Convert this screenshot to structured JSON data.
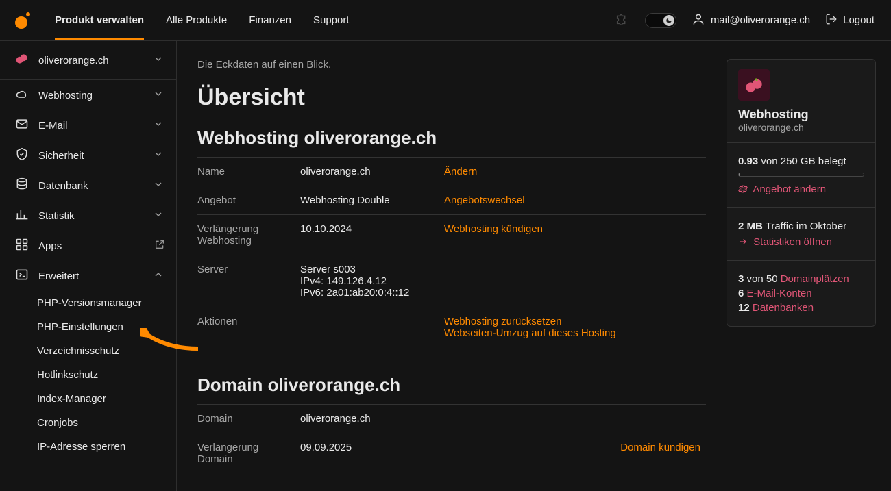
{
  "nav": {
    "items": [
      "Produkt verwalten",
      "Alle Produkte",
      "Finanzen",
      "Support"
    ],
    "active": 0
  },
  "user_email": "mail@oliverorange.ch",
  "logout_label": "Logout",
  "sidebar": {
    "domain": "oliverorange.ch",
    "items": [
      {
        "icon": "cloud",
        "label": "Webhosting",
        "expand": true
      },
      {
        "icon": "mail",
        "label": "E-Mail",
        "expand": true
      },
      {
        "icon": "shield",
        "label": "Sicherheit",
        "expand": true
      },
      {
        "icon": "db",
        "label": "Datenbank",
        "expand": true
      },
      {
        "icon": "stats",
        "label": "Statistik",
        "expand": true
      },
      {
        "icon": "apps",
        "label": "Apps",
        "ext": true
      },
      {
        "icon": "terminal",
        "label": "Erweitert",
        "open": true
      }
    ],
    "sub": [
      "PHP-Versionsmanager",
      "PHP-Einstellungen",
      "Verzeichnisschutz",
      "Hotlinkschutz",
      "Index-Manager",
      "Cronjobs",
      "IP-Adresse sperren"
    ]
  },
  "content": {
    "intro": "Die Eckdaten auf einen Blick.",
    "title": "Übersicht",
    "webhosting": {
      "heading": "Webhosting oliverorange.ch",
      "rows": [
        {
          "k": "Name",
          "v": "oliverorange.ch",
          "actions": [
            "Ändern"
          ]
        },
        {
          "k": "Angebot",
          "v": "Webhosting Double",
          "actions": [
            "Angebotswechsel"
          ]
        },
        {
          "k": "Verlängerung Webhosting",
          "v": "10.10.2024",
          "actions": [
            "Webhosting kündigen"
          ]
        },
        {
          "k": "Server",
          "v": "Server s003\nIPv4: 149.126.4.12\nIPv6: 2a01:ab20:0:4::12",
          "actions": []
        },
        {
          "k": "Aktionen",
          "v": "",
          "actions": [
            "Webhosting zurücksetzen",
            "Webseiten-Umzug auf dieses Hosting"
          ]
        }
      ]
    },
    "domain": {
      "heading": "Domain oliverorange.ch",
      "rows": [
        {
          "k": "Domain",
          "v": "oliverorange.ch",
          "actions": [],
          "align": "left"
        },
        {
          "k": "Verlängerung Domain",
          "v": "09.09.2025",
          "actions": [
            "Domain kündigen"
          ],
          "align": "right"
        }
      ]
    }
  },
  "card": {
    "title": "Webhosting",
    "subtitle": "oliverorange.ch",
    "storage": {
      "used": "0.93",
      "total_suffix": " von 250 GB belegt"
    },
    "change_plan": "Angebot ändern",
    "traffic": {
      "value": "2 MB",
      "suffix": " Traffic im Oktober"
    },
    "stats_link": "Statistiken öffnen",
    "counts": [
      {
        "n": "3",
        "suffix": " von 50 ",
        "link": "Domainplätzen"
      },
      {
        "n": "6",
        "suffix": " ",
        "link": "E-Mail-Konten"
      },
      {
        "n": "12",
        "suffix": " ",
        "link": "Datenbanken"
      }
    ]
  }
}
